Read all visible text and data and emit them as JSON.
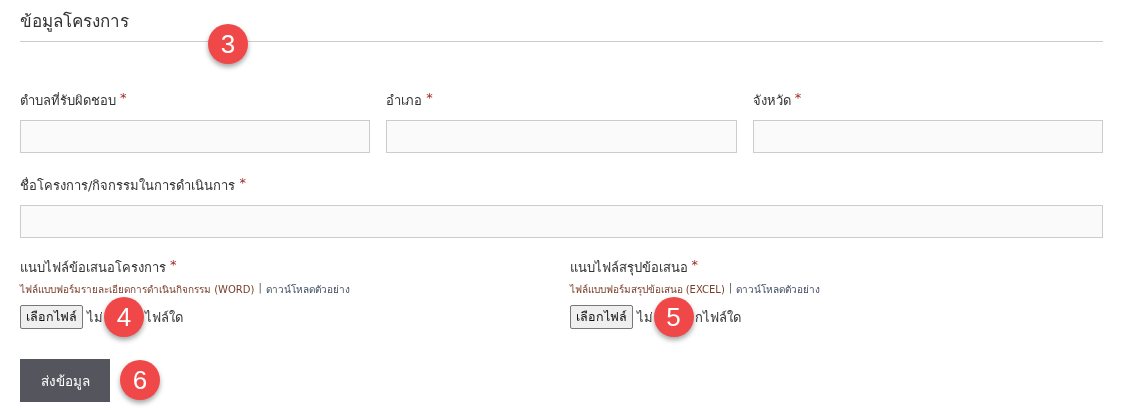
{
  "section": {
    "title": "ข้อมูลโครงการ",
    "badge": "3"
  },
  "location_fields": [
    {
      "label": "ตำบลที่รับผิดชอบ",
      "required_mark": "*"
    },
    {
      "label": "อำเภอ",
      "required_mark": "*"
    },
    {
      "label": "จังหวัด",
      "required_mark": "*"
    }
  ],
  "project_field": {
    "label": "ชื่อโครงการ/กิจกรรมในการดำเนินการ",
    "required_mark": "*"
  },
  "attachments": [
    {
      "label": "แนบไฟล์ข้อเสนอโครงการ",
      "required_mark": "*",
      "hint": "ไฟล์แบบฟอร์มรายละเอียดการดำเนินกิจกรรม (WORD)",
      "separator": "|",
      "link": "ดาวน์โหลดตัวอย่าง",
      "button": "เลือกไฟล์",
      "status_before": "ไม่",
      "status_after": "ไฟล์ใด",
      "badge": "4"
    },
    {
      "label": "แนบไฟล์สรุปข้อเสนอ",
      "required_mark": "*",
      "hint": "ไฟล์แบบฟอร์มสรุปข้อเสนอ (EXCEL)",
      "separator": "|",
      "link": "ดาวน์โหลดตัวอย่าง",
      "button": "เลือกไฟล์",
      "status_before": "ไม่",
      "status_after": "กไฟล์ใด",
      "badge": "5"
    }
  ],
  "submit": {
    "label": "ส่งข้อมูล",
    "badge": "6"
  }
}
